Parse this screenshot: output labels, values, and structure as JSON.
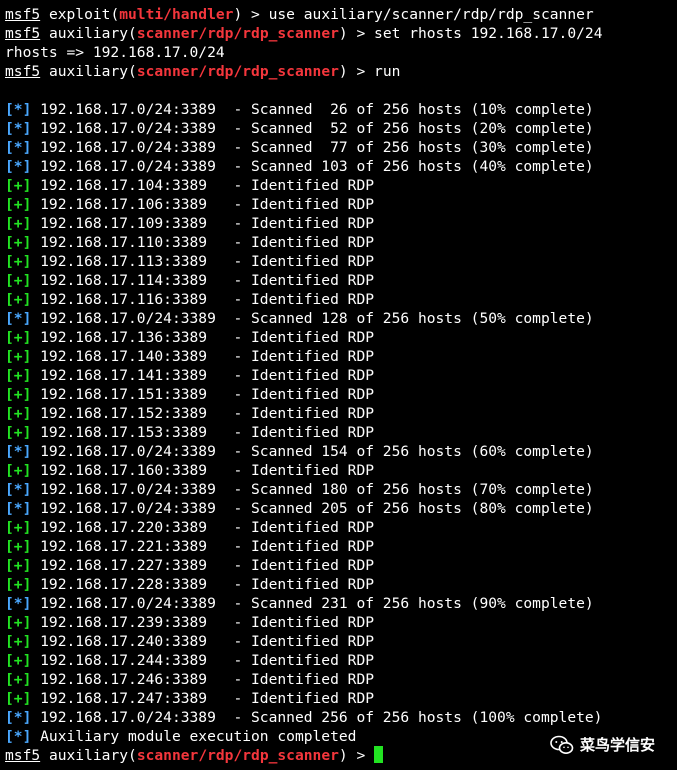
{
  "prompt_lines": [
    {
      "user": "msf5",
      "pre": " exploit(",
      "module": "multi/handler",
      "post": ") > use auxiliary/scanner/rdp/rdp_scanner"
    },
    {
      "user": "msf5",
      "pre": " auxiliary(",
      "module": "scanner/rdp/rdp_scanner",
      "post": ") > set rhosts 192.168.17.0/24"
    }
  ],
  "output_rhosts": "rhosts => 192.168.17.0/24",
  "run_line": {
    "user": "msf5",
    "pre": " auxiliary(",
    "module": "scanner/rdp/rdp_scanner",
    "post": ") > run"
  },
  "scan_lines": [
    {
      "tag": "[*]",
      "text": " 192.168.17.0/24:3389  - Scanned  26 of 256 hosts (10% complete)"
    },
    {
      "tag": "[*]",
      "text": " 192.168.17.0/24:3389  - Scanned  52 of 256 hosts (20% complete)"
    },
    {
      "tag": "[*]",
      "text": " 192.168.17.0/24:3389  - Scanned  77 of 256 hosts (30% complete)"
    },
    {
      "tag": "[*]",
      "text": " 192.168.17.0/24:3389  - Scanned 103 of 256 hosts (40% complete)"
    },
    {
      "tag": "[+]",
      "text": " 192.168.17.104:3389   - Identified RDP"
    },
    {
      "tag": "[+]",
      "text": " 192.168.17.106:3389   - Identified RDP"
    },
    {
      "tag": "[+]",
      "text": " 192.168.17.109:3389   - Identified RDP"
    },
    {
      "tag": "[+]",
      "text": " 192.168.17.110:3389   - Identified RDP"
    },
    {
      "tag": "[+]",
      "text": " 192.168.17.113:3389   - Identified RDP"
    },
    {
      "tag": "[+]",
      "text": " 192.168.17.114:3389   - Identified RDP"
    },
    {
      "tag": "[+]",
      "text": " 192.168.17.116:3389   - Identified RDP"
    },
    {
      "tag": "[*]",
      "text": " 192.168.17.0/24:3389  - Scanned 128 of 256 hosts (50% complete)"
    },
    {
      "tag": "[+]",
      "text": " 192.168.17.136:3389   - Identified RDP"
    },
    {
      "tag": "[+]",
      "text": " 192.168.17.140:3389   - Identified RDP"
    },
    {
      "tag": "[+]",
      "text": " 192.168.17.141:3389   - Identified RDP"
    },
    {
      "tag": "[+]",
      "text": " 192.168.17.151:3389   - Identified RDP"
    },
    {
      "tag": "[+]",
      "text": " 192.168.17.152:3389   - Identified RDP"
    },
    {
      "tag": "[+]",
      "text": " 192.168.17.153:3389   - Identified RDP"
    },
    {
      "tag": "[*]",
      "text": " 192.168.17.0/24:3389  - Scanned 154 of 256 hosts (60% complete)"
    },
    {
      "tag": "[+]",
      "text": " 192.168.17.160:3389   - Identified RDP"
    },
    {
      "tag": "[*]",
      "text": " 192.168.17.0/24:3389  - Scanned 180 of 256 hosts (70% complete)"
    },
    {
      "tag": "[*]",
      "text": " 192.168.17.0/24:3389  - Scanned 205 of 256 hosts (80% complete)"
    },
    {
      "tag": "[+]",
      "text": " 192.168.17.220:3389   - Identified RDP"
    },
    {
      "tag": "[+]",
      "text": " 192.168.17.221:3389   - Identified RDP"
    },
    {
      "tag": "[+]",
      "text": " 192.168.17.227:3389   - Identified RDP"
    },
    {
      "tag": "[+]",
      "text": " 192.168.17.228:3389   - Identified RDP"
    },
    {
      "tag": "[*]",
      "text": " 192.168.17.0/24:3389  - Scanned 231 of 256 hosts (90% complete)"
    },
    {
      "tag": "[+]",
      "text": " 192.168.17.239:3389   - Identified RDP"
    },
    {
      "tag": "[+]",
      "text": " 192.168.17.240:3389   - Identified RDP"
    },
    {
      "tag": "[+]",
      "text": " 192.168.17.244:3389   - Identified RDP"
    },
    {
      "tag": "[+]",
      "text": " 192.168.17.246:3389   - Identified RDP"
    },
    {
      "tag": "[+]",
      "text": " 192.168.17.247:3389   - Identified RDP"
    },
    {
      "tag": "[*]",
      "text": " 192.168.17.0/24:3389  - Scanned 256 of 256 hosts (100% complete)"
    },
    {
      "tag": "[*]",
      "text": " Auxiliary module execution completed"
    }
  ],
  "final_prompt": {
    "user": "msf5",
    "pre": " auxiliary(",
    "module": "scanner/rdp/rdp_scanner",
    "post": ") > "
  },
  "watermark": {
    "text": "菜鸟学信安",
    "icon": "wechat-icon"
  },
  "colors": {
    "background": "#000000",
    "text": "#ffffff",
    "module": "#f4363c",
    "info": "#4aa8ff",
    "good": "#22e322"
  }
}
